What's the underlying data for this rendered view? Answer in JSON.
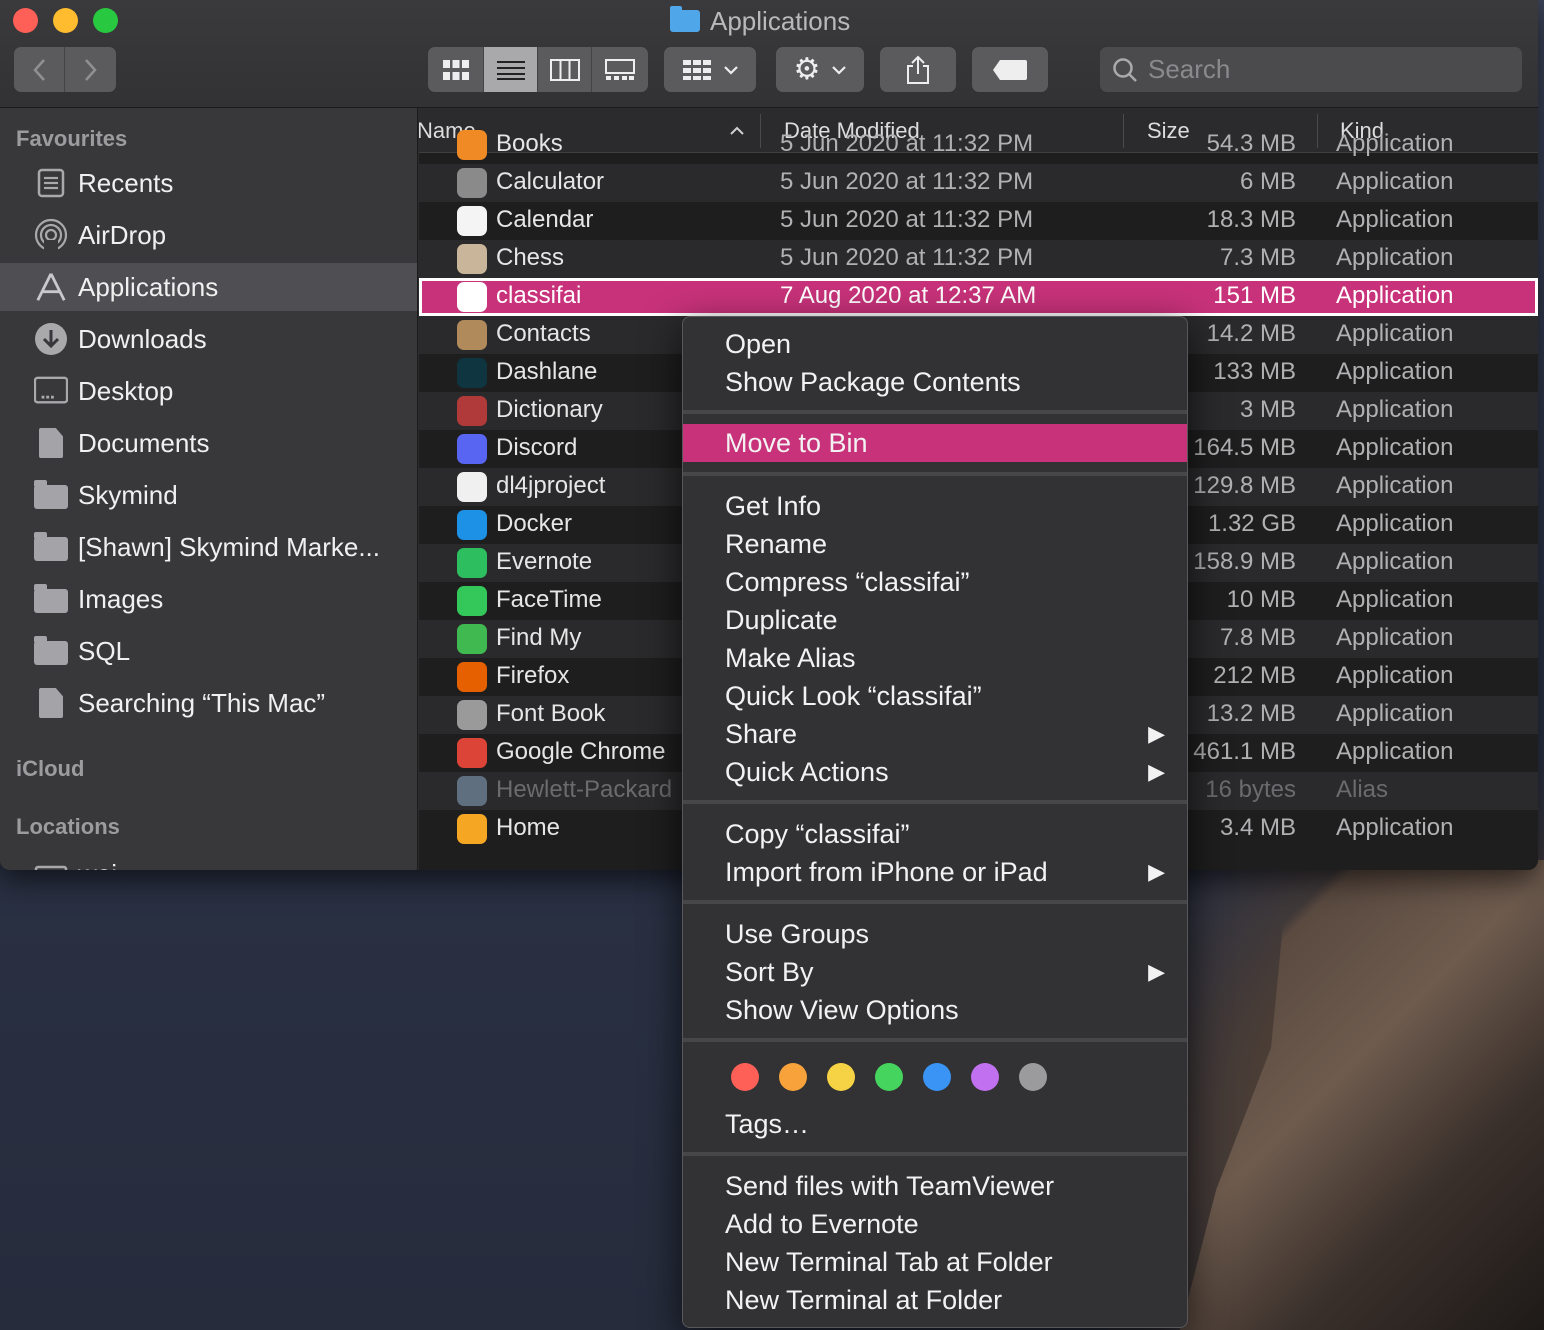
{
  "window": {
    "title": "Applications"
  },
  "toolbar": {
    "back_icon": "chevron-left-icon",
    "forward_icon": "chevron-right-icon",
    "views": [
      "icon-view",
      "list-view",
      "column-view",
      "gallery-view"
    ],
    "active_view": "list-view",
    "group_icon": "grid-icon",
    "action_icon": "gear-icon",
    "share_icon": "share-icon",
    "tag_icon": "tag-icon",
    "search_placeholder": "Search"
  },
  "sidebar": {
    "sections": {
      "favourites": "Favourites",
      "icloud": "iCloud",
      "locations": "Locations"
    },
    "items": [
      {
        "label": "Recents",
        "icon": "recents-icon"
      },
      {
        "label": "AirDrop",
        "icon": "airdrop-icon"
      },
      {
        "label": "Applications",
        "icon": "applications-icon",
        "selected": true
      },
      {
        "label": "Downloads",
        "icon": "downloads-icon"
      },
      {
        "label": "Desktop",
        "icon": "desktop-icon"
      },
      {
        "label": "Documents",
        "icon": "documents-icon"
      },
      {
        "label": "Skymind",
        "icon": "folder-icon"
      },
      {
        "label": "[Shawn] Skymind Marke...",
        "icon": "folder-icon"
      },
      {
        "label": "Images",
        "icon": "folder-icon"
      },
      {
        "label": "SQL",
        "icon": "folder-icon"
      },
      {
        "label": "Searching “This Mac”",
        "icon": "document-icon"
      }
    ],
    "locations_partial": "wei"
  },
  "list": {
    "columns": {
      "name": "Name",
      "date": "Date Modified",
      "size": "Size",
      "kind": "Kind"
    },
    "sort_icon": "chevron-up-icon",
    "rows": [
      {
        "name": "Books",
        "date": "5 Jun 2020 at 11:32 PM",
        "size": "54.3 MB",
        "kind": "Application",
        "color": "#f08a24"
      },
      {
        "name": "Calculator",
        "date": "5 Jun 2020 at 11:32 PM",
        "size": "6 MB",
        "kind": "Application",
        "color": "#8a8a8a"
      },
      {
        "name": "Calendar",
        "date": "5 Jun 2020 at 11:32 PM",
        "size": "18.3 MB",
        "kind": "Application",
        "color": "#f4f4f4"
      },
      {
        "name": "Chess",
        "date": "5 Jun 2020 at 11:32 PM",
        "size": "7.3 MB",
        "kind": "Application",
        "color": "#c9b69a"
      },
      {
        "name": "classifai",
        "date": "7 Aug 2020 at 12:37 AM",
        "size": "151 MB",
        "kind": "Application",
        "color": "#ffffff",
        "selected": true
      },
      {
        "name": "Contacts",
        "date": "",
        "size": "14.2 MB",
        "kind": "Application",
        "color": "#b08a5a"
      },
      {
        "name": "Dashlane",
        "date": "",
        "size": "133 MB",
        "kind": "Application",
        "color": "#0f3540"
      },
      {
        "name": "Dictionary",
        "date": "",
        "size": "3 MB",
        "kind": "Application",
        "color": "#b03a3a"
      },
      {
        "name": "Discord",
        "date": "",
        "size": "164.5 MB",
        "kind": "Application",
        "color": "#5865f2"
      },
      {
        "name": "dl4jproject",
        "date": "",
        "size": "129.8 MB",
        "kind": "Application",
        "color": "#f0f0f0"
      },
      {
        "name": "Docker",
        "date": "",
        "size": "1.32 GB",
        "kind": "Application",
        "color": "#1d91e6"
      },
      {
        "name": "Evernote",
        "date": "",
        "size": "158.9 MB",
        "kind": "Application",
        "color": "#2dbe60"
      },
      {
        "name": "FaceTime",
        "date": "",
        "size": "10 MB",
        "kind": "Application",
        "color": "#34c759"
      },
      {
        "name": "Find My",
        "date": "",
        "size": "7.8 MB",
        "kind": "Application",
        "color": "#3fb950"
      },
      {
        "name": "Firefox",
        "date": "",
        "size": "212 MB",
        "kind": "Application",
        "color": "#e66000"
      },
      {
        "name": "Font Book",
        "date": "",
        "size": "13.2 MB",
        "kind": "Application",
        "color": "#9a9a9a"
      },
      {
        "name": "Google Chrome",
        "date": "",
        "size": "461.1 MB",
        "kind": "Application",
        "color": "#db4437"
      },
      {
        "name": "Hewlett-Packard",
        "date": "",
        "size": "16 bytes",
        "kind": "Alias",
        "color": "#5f6f80",
        "dim": true
      },
      {
        "name": "Home",
        "date": "",
        "size": "3.4 MB",
        "kind": "Application",
        "color": "#f5a623"
      }
    ]
  },
  "context_menu": {
    "groups": [
      [
        {
          "label": "Open"
        },
        {
          "label": "Show Package Contents"
        }
      ],
      [
        {
          "label": "Move to Bin",
          "highlighted": true
        }
      ],
      [
        {
          "label": "Get Info"
        },
        {
          "label": "Rename"
        },
        {
          "label": "Compress “classifai”"
        },
        {
          "label": "Duplicate"
        },
        {
          "label": "Make Alias"
        },
        {
          "label": "Quick Look “classifai”"
        },
        {
          "label": "Share",
          "submenu": true
        },
        {
          "label": "Quick Actions",
          "submenu": true
        }
      ],
      [
        {
          "label": "Copy “classifai”"
        },
        {
          "label": "Import from iPhone or iPad",
          "submenu": true
        }
      ],
      [
        {
          "label": "Use Groups"
        },
        {
          "label": "Sort By",
          "submenu": true
        },
        {
          "label": "Show View Options"
        }
      ],
      [
        {
          "label": "Tags…"
        }
      ],
      [
        {
          "label": "Send files with TeamViewer"
        },
        {
          "label": "Add to Evernote"
        },
        {
          "label": "New Terminal Tab at Folder"
        },
        {
          "label": "New Terminal at Folder"
        }
      ]
    ],
    "submenu_glyph": "▶",
    "tag_colors": [
      "#fe5f57",
      "#f7a23b",
      "#f6d344",
      "#45d45d",
      "#3a94f5",
      "#c170f0",
      "#9b9b9e"
    ]
  }
}
